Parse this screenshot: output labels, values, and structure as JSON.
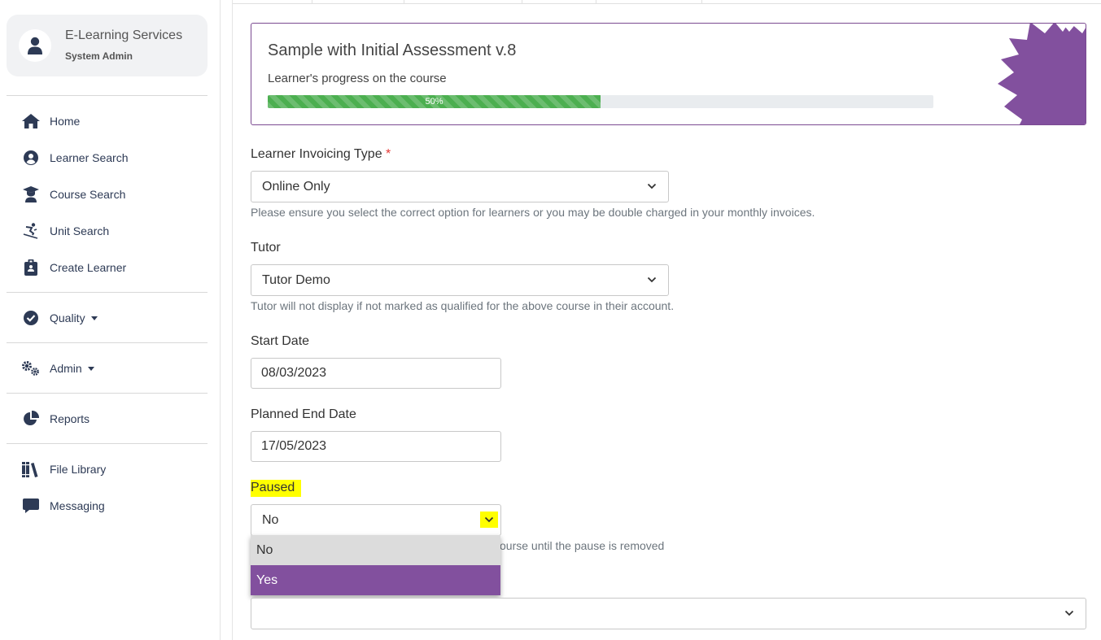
{
  "sidebar": {
    "org_name": "E-Learning Services",
    "role": "System Admin",
    "items": [
      {
        "label": "Home",
        "icon": "home-icon"
      },
      {
        "label": "Learner Search",
        "icon": "user-circle-icon"
      },
      {
        "label": "Course Search",
        "icon": "graduate-icon"
      },
      {
        "label": "Unit Search",
        "icon": "skier-icon"
      },
      {
        "label": "Create Learner",
        "icon": "clipboard-icon"
      },
      {
        "label": "Quality",
        "icon": "check-circle-icon"
      },
      {
        "label": "Admin",
        "icon": "cogs-icon"
      },
      {
        "label": "Reports",
        "icon": "pie-chart-icon"
      },
      {
        "label": "File Library",
        "icon": "books-icon"
      },
      {
        "label": "Messaging",
        "icon": "comment-icon"
      }
    ]
  },
  "course": {
    "title": "Sample with Initial Assessment v.8",
    "subtitle": "Learner's progress on the course",
    "progress_label": "50%",
    "progress_value": 0.5
  },
  "form": {
    "invoicing": {
      "label": "Learner Invoicing Type",
      "required_mark": "*",
      "value": "Online Only",
      "help": "Please ensure you select the correct option for learners or you may be double charged in your monthly invoices."
    },
    "tutor": {
      "label": "Tutor",
      "value": "Tutor Demo",
      "help": "Tutor will not display if not marked as qualified for the above course in their account."
    },
    "start_date": {
      "label": "Start Date",
      "value": "08/03/2023"
    },
    "end_date": {
      "label": "Planned End Date",
      "value": "17/05/2023"
    },
    "paused": {
      "label": "Paused",
      "value": "No",
      "help_partial": "ourse until the pause is removed",
      "options": [
        "No",
        "Yes"
      ]
    },
    "next_select": {
      "value": ""
    }
  },
  "colors": {
    "accent": "#82509e",
    "progress": "#4caf50",
    "highlight": "#ffff00",
    "nav_text": "#2d3a55"
  }
}
